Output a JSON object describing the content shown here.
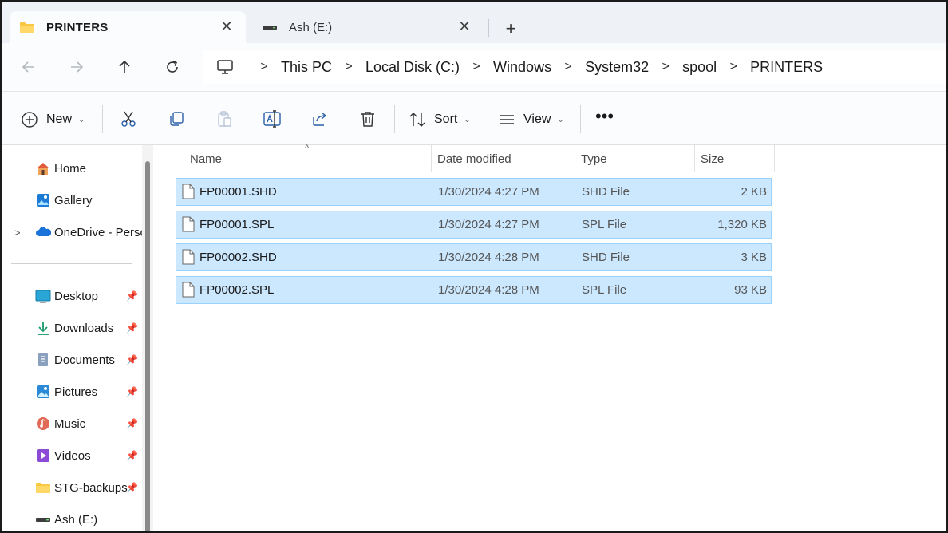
{
  "tabs": [
    {
      "label": "PRINTERS",
      "icon": "folder-icon",
      "active": true
    },
    {
      "label": "Ash (E:)",
      "icon": "drive-icon",
      "active": false
    }
  ],
  "address": {
    "crumbs": [
      "This PC",
      "Local Disk (C:)",
      "Windows",
      "System32",
      "spool",
      "PRINTERS"
    ]
  },
  "toolbar": {
    "new_label": "New",
    "sort_label": "Sort",
    "view_label": "View"
  },
  "sidebar": {
    "items": [
      {
        "label": "Home",
        "icon": "home-icon"
      },
      {
        "label": "Gallery",
        "icon": "gallery-icon"
      },
      {
        "label": "OneDrive - Perso",
        "icon": "onedrive-icon"
      },
      {
        "label": "Desktop",
        "icon": "desktop-icon"
      },
      {
        "label": "Downloads",
        "icon": "downloads-icon"
      },
      {
        "label": "Documents",
        "icon": "documents-icon"
      },
      {
        "label": "Pictures",
        "icon": "pictures-icon"
      },
      {
        "label": "Music",
        "icon": "music-icon"
      },
      {
        "label": "Videos",
        "icon": "videos-icon"
      },
      {
        "label": "STG-backups",
        "icon": "folder-icon"
      },
      {
        "label": "Ash (E:)",
        "icon": "drive-icon"
      }
    ]
  },
  "columns": {
    "name": "Name",
    "date": "Date modified",
    "type": "Type",
    "size": "Size"
  },
  "files": [
    {
      "name": "FP00001.SHD",
      "date": "1/30/2024 4:27 PM",
      "type": "SHD File",
      "size": "2 KB"
    },
    {
      "name": "FP00001.SPL",
      "date": "1/30/2024 4:27 PM",
      "type": "SPL File",
      "size": "1,320 KB"
    },
    {
      "name": "FP00002.SHD",
      "date": "1/30/2024 4:28 PM",
      "type": "SHD File",
      "size": "3 KB"
    },
    {
      "name": "FP00002.SPL",
      "date": "1/30/2024 4:28 PM",
      "type": "SPL File",
      "size": "93 KB"
    }
  ],
  "colors": {
    "selection_fill": "#cce8ff",
    "selection_border": "#99d1ff",
    "folder_yellow": "#f8c842"
  }
}
